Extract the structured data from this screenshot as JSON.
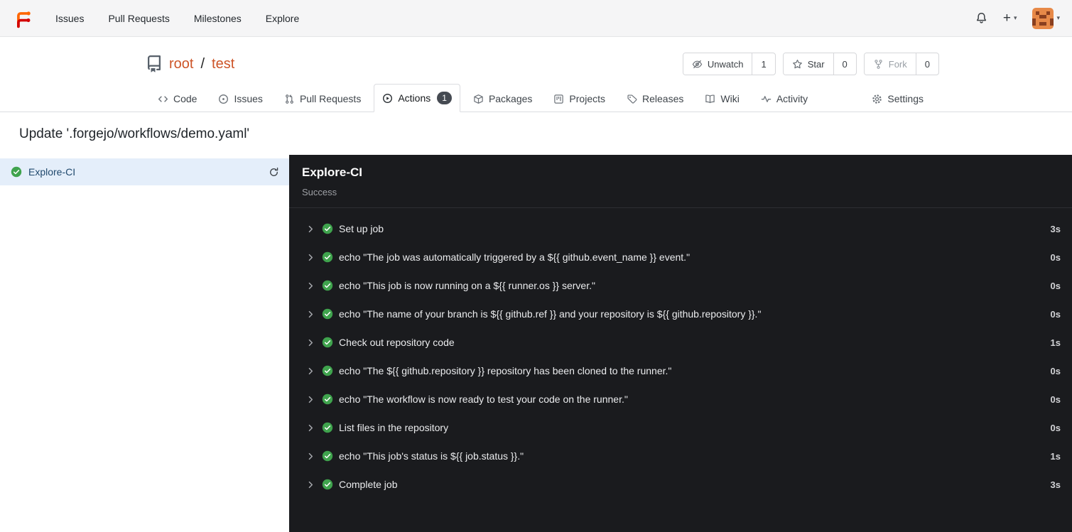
{
  "colors": {
    "primary_orange": "#cd5427",
    "logo_orange": "#ff6600",
    "logo_red": "#d40000",
    "success_green": "#3fa34d",
    "selected_job_bg": "#e4eefa",
    "dark_panel_bg": "#1a1b1e",
    "badge_bg": "#454a52"
  },
  "icons": {
    "notifications": "bell-icon",
    "create_new": "plus-icon with caret-down-icon",
    "user_menu": "avatar with caret-down-icon",
    "repo": "repo-book-icon",
    "job_status": "check-circle-icon",
    "step_expand": "chevron-right-icon",
    "job_refresh": "sync-icon"
  },
  "navbar": {
    "items": [
      {
        "label": "Issues"
      },
      {
        "label": "Pull Requests"
      },
      {
        "label": "Milestones"
      },
      {
        "label": "Explore"
      }
    ]
  },
  "repo": {
    "owner": "root",
    "separator": "/",
    "name": "test",
    "watch": {
      "label": "Unwatch",
      "count": "1",
      "icon": "eye-slash-icon"
    },
    "star": {
      "label": "Star",
      "count": "0",
      "icon": "star-icon"
    },
    "fork": {
      "label": "Fork",
      "count": "0",
      "icon": "git-fork-icon"
    }
  },
  "tabs": [
    {
      "label": "Code",
      "icon": "code-icon"
    },
    {
      "label": "Issues",
      "icon": "issue-circle-icon"
    },
    {
      "label": "Pull Requests",
      "icon": "git-pull-request-icon"
    },
    {
      "label": "Actions",
      "icon": "play-circle-icon",
      "badge": "1",
      "active": true
    },
    {
      "label": "Packages",
      "icon": "package-icon"
    },
    {
      "label": "Projects",
      "icon": "project-board-icon"
    },
    {
      "label": "Releases",
      "icon": "tag-icon"
    },
    {
      "label": "Wiki",
      "icon": "book-icon"
    },
    {
      "label": "Activity",
      "icon": "pulse-icon"
    },
    {
      "label": "Settings",
      "icon": "gear-icon",
      "align": "right"
    }
  ],
  "page": {
    "title": "Update '.forgejo/workflows/demo.yaml'"
  },
  "sidebar": {
    "jobs": [
      {
        "name": "Explore-CI",
        "status": "success"
      }
    ]
  },
  "run_panel": {
    "title": "Explore-CI",
    "status": "Success",
    "steps": [
      {
        "name": "Set up job",
        "duration": "3s"
      },
      {
        "name": "echo \"The job was automatically triggered by a ${{ github.event_name }} event.\"",
        "duration": "0s"
      },
      {
        "name": "echo \"This job is now running on a ${{ runner.os }} server.\"",
        "duration": "0s"
      },
      {
        "name": "echo \"The name of your branch is ${{ github.ref }} and your repository is ${{ github.repository }}.\"",
        "duration": "0s"
      },
      {
        "name": "Check out repository code",
        "duration": "1s"
      },
      {
        "name": "echo \"The ${{ github.repository }} repository has been cloned to the runner.\"",
        "duration": "0s"
      },
      {
        "name": "echo \"The workflow is now ready to test your code on the runner.\"",
        "duration": "0s"
      },
      {
        "name": "List files in the repository",
        "duration": "0s"
      },
      {
        "name": "echo \"This job's status is ${{ job.status }}.\"",
        "duration": "1s"
      },
      {
        "name": "Complete job",
        "duration": "3s"
      }
    ]
  }
}
